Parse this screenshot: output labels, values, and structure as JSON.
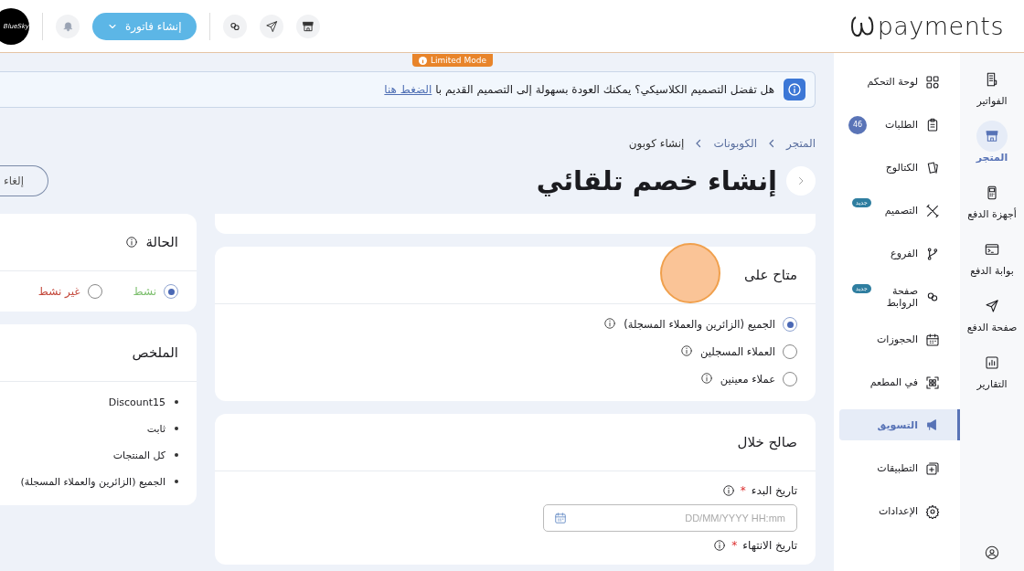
{
  "header": {
    "logo": "payments",
    "avatar": "BlueSky",
    "create_button": "إنشاء فاتورة"
  },
  "limited_badge": "Limited Mode",
  "banner": {
    "text": "هل تفضل التصميم الكلاسيكي؟ يمكنك العودة بسهولة إلى التصميم القديم با",
    "link": "الضغط هنا"
  },
  "breadcrumb": [
    "المتجر",
    "الكوبونات",
    "إنشاء كوبون"
  ],
  "title": "إنشاء خصم تلقائي",
  "cancel_button": "إلغاء",
  "availability": {
    "title": "متاح على",
    "options": [
      {
        "label": "الجميع (الزائرين والعملاء المسجلة)",
        "selected": true
      },
      {
        "label": "العملاء المسجلين",
        "selected": false
      },
      {
        "label": "عملاء معينين",
        "selected": false
      }
    ]
  },
  "validity": {
    "title": "صالح خلال",
    "start_label": "تاريخ البدء",
    "start_required": "*",
    "start_placeholder": "DD/MM/YYYY HH:mm",
    "end_label": "تاريخ الانتهاء",
    "end_required": "*"
  },
  "status": {
    "title": "الحالة",
    "options": [
      {
        "label": "نشط",
        "selected": true,
        "color": "#7dbf6e"
      },
      {
        "label": "غير نشط",
        "selected": false,
        "color": "#c4493c"
      }
    ]
  },
  "summary": {
    "title": "الملخص",
    "items": [
      "Discount15",
      "ثابت",
      "كل المنتجات",
      "الجميع (الزائرين والعملاء المسجلة)"
    ]
  },
  "sidebar": {
    "items": [
      {
        "label": "لوحة التحكم",
        "selected": false
      },
      {
        "label": "الطلبات",
        "selected": false,
        "count": "46"
      },
      {
        "label": "الكتالوج",
        "selected": false
      },
      {
        "label": "التصميم",
        "selected": false,
        "badge": "جديد"
      },
      {
        "label": "الفروع",
        "selected": false
      },
      {
        "label": "صفحة الروابط",
        "selected": false,
        "badge": "جديد"
      },
      {
        "label": "الحجوزات",
        "selected": false
      },
      {
        "label": "في المطعم",
        "selected": false
      },
      {
        "label": "التسويق",
        "selected": true
      },
      {
        "label": "التطبيقات",
        "selected": false
      },
      {
        "label": "الإعدادات",
        "selected": false
      }
    ]
  },
  "rail": {
    "items": [
      {
        "label": "الفواتير",
        "selected": false
      },
      {
        "label": "المتجر",
        "selected": true
      },
      {
        "label": "أجهزة الدفع",
        "selected": false
      },
      {
        "label": "بوابة الدفع",
        "selected": false
      },
      {
        "label": "صفحة الدفع",
        "selected": false
      },
      {
        "label": "التقارير",
        "selected": false
      }
    ]
  }
}
